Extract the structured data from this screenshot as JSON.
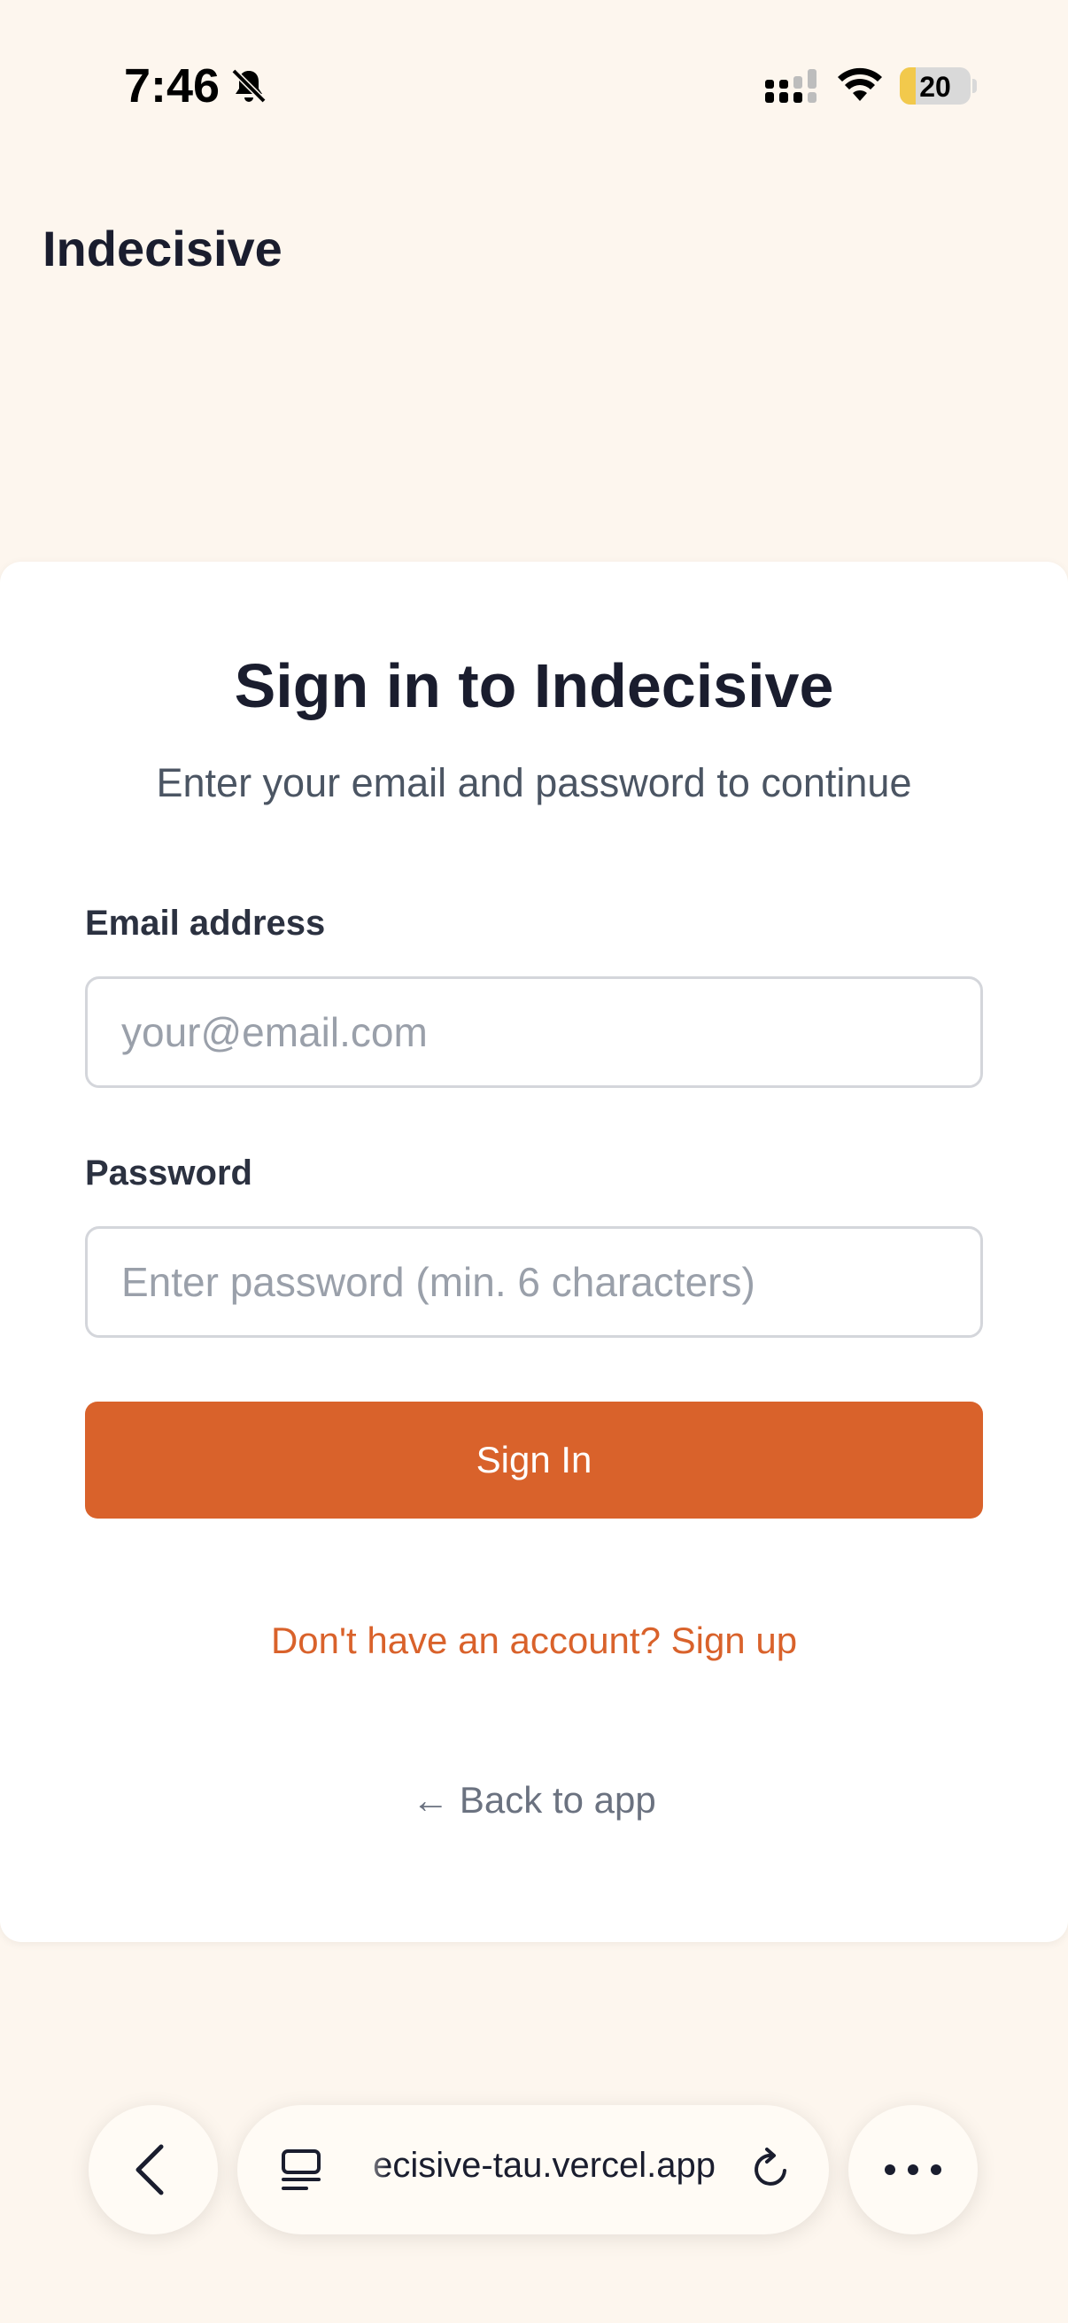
{
  "status_bar": {
    "time": "7:46",
    "battery": "20",
    "battery_color": "#f2c94c",
    "icons": [
      "bell-slash-icon",
      "signal-icon",
      "wifi-icon",
      "battery-icon"
    ]
  },
  "app": {
    "title": "Indecisive"
  },
  "signin": {
    "title": "Sign in to Indecisive",
    "subtitle": "Enter your email and password to continue",
    "email_label": "Email address",
    "email_value": "",
    "email_placeholder": "your@email.com",
    "password_label": "Password",
    "password_value": "",
    "password_placeholder": "Enter password (min. 6 characters)",
    "submit_label": "Sign In",
    "signup_link": "Don't have an account? Sign up",
    "back_link": "← Back to app"
  },
  "browser": {
    "url": "ecisive-tau.vercel.app",
    "icons": [
      "back-chevron-icon",
      "tabs-icon",
      "reload-icon",
      "more-icon"
    ]
  },
  "colors": {
    "accent": "#d9622b",
    "background": "#fdf6ee",
    "card": "#ffffff",
    "text": "#1a1d2e"
  }
}
